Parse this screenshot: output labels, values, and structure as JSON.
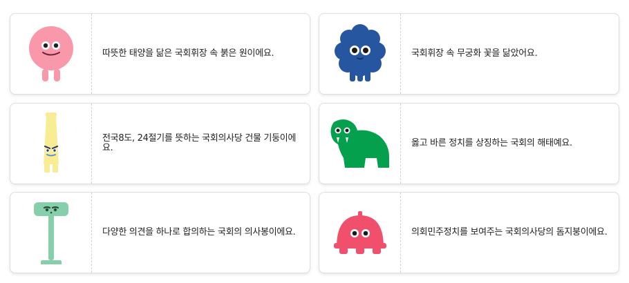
{
  "cards": [
    {
      "character": "pink-round-sun-character",
      "color": "#f998ab",
      "text": "따뜻한 태양을 닮은 국회휘장 속 붉은 원이에요."
    },
    {
      "character": "blue-flower-character",
      "color": "#2756a1",
      "text": "국회휘장 속 무궁화 꽃을 닮았어요."
    },
    {
      "character": "yellow-pillar-character",
      "color": "#f8ec94",
      "text": "전국8도, 24절기를 뜻하는 국회의사당 건물 기둥이에요."
    },
    {
      "character": "green-haetae-character",
      "color": "#04a04e",
      "text": "옳고 바른 정치를 상징하는 국회의 해태예요."
    },
    {
      "character": "mint-stick-character",
      "color": "#86cfab",
      "text": "다양한 의견을 하나로 합의하는 국회의 의사봉이에요."
    },
    {
      "character": "red-dome-character",
      "color": "#f0506b",
      "text": "의회민주정치를 보여주는 국회의사당의 돔지붕이에요."
    }
  ]
}
